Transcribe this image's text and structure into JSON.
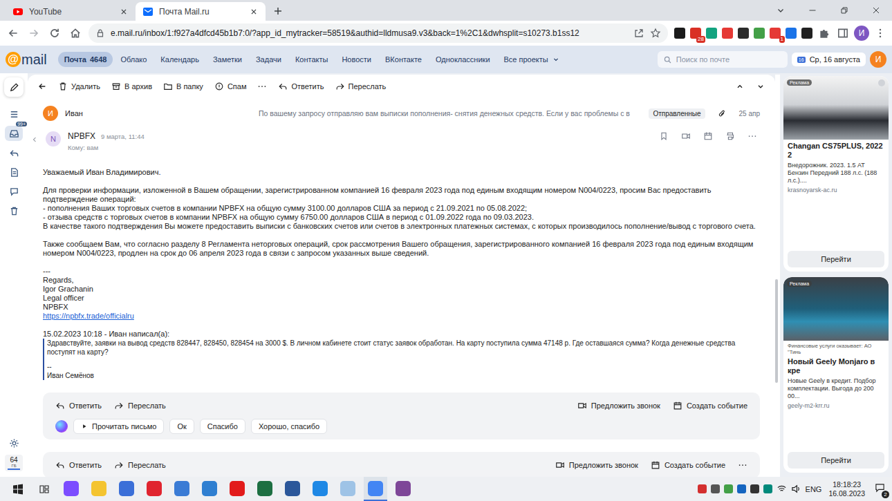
{
  "browser": {
    "tabs": [
      {
        "label": "YouTube",
        "selected": false
      },
      {
        "label": "Почта Mail.ru",
        "selected": true
      }
    ],
    "address": "e.mail.ru/inbox/1:f927a4dfcd45b1b7:0/?app_id_mytracker=58519&authid=lldmusa9.v3&back=1%2C1&dwhsplit=s10273.b1ss12",
    "extensions": [
      {
        "color": "#1b1b1b",
        "badge": ""
      },
      {
        "color": "#d93025",
        "badge": "28"
      },
      {
        "color": "#12a37f",
        "badge": ""
      },
      {
        "color": "#e53935",
        "badge": ""
      },
      {
        "color": "#2b2b2b",
        "badge": ""
      },
      {
        "color": "#43a047",
        "badge": ""
      },
      {
        "color": "#e53935",
        "badge": "1"
      },
      {
        "color": "#1a73e8",
        "badge": ""
      },
      {
        "color": "#212121",
        "badge": ""
      }
    ],
    "profile": "И"
  },
  "mail_header": {
    "logo_mark": "@",
    "logo_text": "mail",
    "nav": [
      {
        "label": "Почта",
        "count": "4648",
        "selected": true,
        "dropdown": false
      },
      {
        "label": "Облако",
        "count": "",
        "selected": false,
        "dropdown": false
      },
      {
        "label": "Календарь",
        "count": "",
        "selected": false,
        "dropdown": false
      },
      {
        "label": "Заметки",
        "count": "",
        "selected": false,
        "dropdown": false
      },
      {
        "label": "Задачи",
        "count": "",
        "selected": false,
        "dropdown": false
      },
      {
        "label": "Контакты",
        "count": "",
        "selected": false,
        "dropdown": false
      },
      {
        "label": "Новости",
        "count": "",
        "selected": false,
        "dropdown": false
      },
      {
        "label": "ВКонтакте",
        "count": "",
        "selected": false,
        "dropdown": false
      },
      {
        "label": "Одноклассники",
        "count": "",
        "selected": false,
        "dropdown": false
      },
      {
        "label": "Все проекты",
        "count": "",
        "selected": false,
        "dropdown": true
      }
    ],
    "search_placeholder": "Поиск по почте",
    "calendar_day": "16",
    "date": "Ср, 16 августа",
    "avatar": "И"
  },
  "sidebar": {
    "inbox_badge": "99+",
    "storage": "64",
    "storage_unit": "ГБ"
  },
  "toolbar": {
    "actions": [
      "Удалить",
      "В архив",
      "В папку",
      "Спам"
    ],
    "reply": "Ответить",
    "forward": "Переслать"
  },
  "thread_item": {
    "avatar": "И",
    "sender": "Иван",
    "snippet": "По вашему запросу отправляю вам выписки пополнения- снятия денежных средств. Если у вас проблемы с в",
    "folder": "Отправленные",
    "date": "25 апр"
  },
  "letter": {
    "avatar": "N",
    "sender": "NPBFX",
    "date": "9 марта, 11:44",
    "to": "Кому: вам",
    "body": [
      [
        "Уважаемый Иван Владимирович."
      ],
      [
        "Для проверки информации, изложенной в Вашем обращении, зарегистрированном компанией 16 февраля 2023 года под единым входящим номером N004/0223, просим Вас предоставить подтверждение операций:",
        "- пополнения Ваших торговых счетов в компании NPBFX на общую сумму 3100.00 долларов США за период с 21.09.2021 по 05.08.2022;",
        "- отзыва средств с торговых счетов в компании NPBFX на общую сумму 6750.00 долларов США в период с 01.09.2022 года по 09.03.2023.",
        "В качестве такого подтверждения Вы можете предоставить выписки с банковских счетов или счетов в электронных платежных системах, с которых производилось пополнение/вывод с торгового счета."
      ],
      [
        "Также сообщаем Вам, что согласно разделу 8 Регламента неторговых операций, срок рассмотрения Вашего обращения, зарегистрированного компанией 16 февраля 2023 года под единым входящим номером N004/0223, продлен на срок до 06 апреля 2023 года в связи с запросом указанных выше сведений."
      ]
    ],
    "signature": [
      "---",
      "Regards,",
      "Igor Grachanin",
      "Legal officer",
      "NPBFX"
    ],
    "link": "https://npbfx.trade/officialru",
    "quote_header": "15.02.2023 10:18 - Иван написал(а):",
    "quote": "Здравствуйте, заявки на вывод средств 828447, 828450, 828454 на 3000 $. В личном кабинете стоит статус заявок обработан. На карту поступила сумма 47148 р. Где оставшаяся сумма? Когда денежные средства поступят на карту?",
    "quote_separator": "--",
    "quote_signature": "Иван Семёнов"
  },
  "reply_bars": [
    {
      "reply": "Ответить",
      "forward": "Переслать",
      "call": "Предложить звонок",
      "event": "Создать событие",
      "quick_replies": [
        "Прочитать письмо",
        "Ок",
        "Спасибо",
        "Хорошо, спасибо"
      ]
    },
    {
      "reply": "Ответить",
      "forward": "Переслать",
      "call": "Предложить звонок",
      "event": "Создать событие",
      "quick_replies": []
    }
  ],
  "ads": [
    {
      "label": "Реклама",
      "disclaimer": "",
      "title": "Changan CS75PLUS, 2022 2",
      "description": "Внедорожник. 2023. 1.5 AT Бензин Передний 188 л.с. (188 л.с.)....",
      "domain": "krasnoyarsk-ac.ru",
      "button": "Перейти"
    },
    {
      "label": "Реклама",
      "disclaimer": "Финансовые услуги оказывает: АО \"Тинь",
      "title": "Новый Geely Monjaro в кре",
      "description": "Новые Geely в кредит. Подбор комплектации. Выгода до 200 00...",
      "domain": "geely-m2-krr.ru",
      "button": "Перейти"
    }
  ],
  "taskbar": {
    "apps": [
      {
        "color": "#7c4dff",
        "active": false
      },
      {
        "color": "#f4c430",
        "active": false
      },
      {
        "color": "#3b6fd8",
        "active": false
      },
      {
        "color": "#e0242f",
        "active": false
      },
      {
        "color": "#3a7bd5",
        "active": false
      },
      {
        "color": "#2f7fd1",
        "active": false
      },
      {
        "color": "#e21b1b",
        "active": false
      },
      {
        "color": "#1d6f42",
        "active": false
      },
      {
        "color": "#2b579a",
        "active": false
      },
      {
        "color": "#1e88e5",
        "active": false
      },
      {
        "color": "#9ec3e6",
        "active": false
      },
      {
        "color": "#4285f4",
        "active": true
      },
      {
        "color": "#7e4798",
        "active": false
      }
    ],
    "tray": [
      {
        "color": "#d32f2f"
      },
      {
        "color": "#555555"
      },
      {
        "color": "#43a047"
      },
      {
        "color": "#1565c0"
      },
      {
        "color": "#333333"
      },
      {
        "color": "#00897b"
      }
    ],
    "lang": "ENG",
    "time": "18:18:23",
    "date": "16.08.2023",
    "notifications": "2"
  }
}
